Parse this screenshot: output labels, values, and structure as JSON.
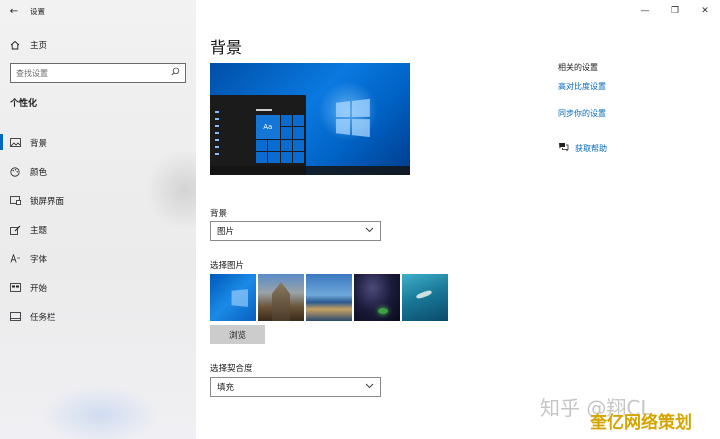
{
  "window": {
    "app_title": "设置",
    "back_glyph": "←",
    "controls": {
      "minimize": "—",
      "maximize": "❐",
      "close": "✕"
    }
  },
  "sidebar": {
    "home_label": "主页",
    "search_placeholder": "查找设置",
    "section_title": "个性化",
    "items": [
      {
        "label": "背景",
        "icon": "image-icon",
        "active": true
      },
      {
        "label": "颜色",
        "icon": "palette-icon",
        "active": false
      },
      {
        "label": "锁屏界面",
        "icon": "lock-screen-icon",
        "active": false
      },
      {
        "label": "主题",
        "icon": "theme-brush-icon",
        "active": false
      },
      {
        "label": "字体",
        "icon": "font-icon",
        "active": false
      },
      {
        "label": "开始",
        "icon": "start-icon",
        "active": false
      },
      {
        "label": "任务栏",
        "icon": "taskbar-icon",
        "active": false
      }
    ]
  },
  "main": {
    "page_title": "背景",
    "preview_tile_text": "Aa",
    "background_label": "背景",
    "background_value": "图片",
    "choose_picture_label": "选择图片",
    "browse_label": "浏览",
    "fit_label": "选择契合度",
    "fit_value": "填充"
  },
  "related": {
    "title": "相关的设置",
    "links": [
      "高对比度设置",
      "同步你的设置"
    ],
    "help_label": "获取帮助"
  },
  "watermark": {
    "text1": "知乎 @翔CL",
    "text2": "奎亿网络策划"
  }
}
